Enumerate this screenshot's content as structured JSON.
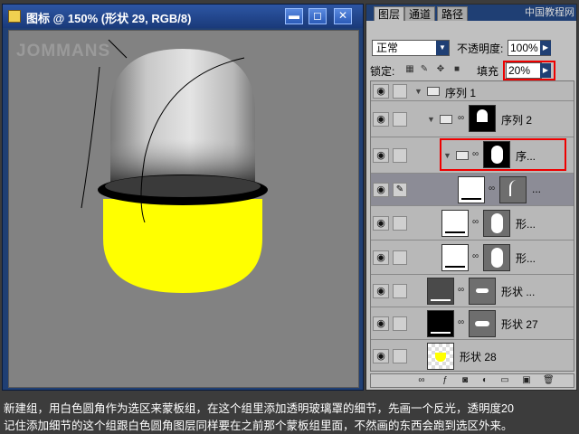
{
  "document": {
    "title": "图标 @ 150% (形状 29, RGB/8)",
    "watermark": "JOMMANS",
    "controls": {
      "minimize": "▬",
      "restore": "◻",
      "close": "✕"
    }
  },
  "layers_panel": {
    "tabs": [
      {
        "label": "图层",
        "active": true
      },
      {
        "label": "通道",
        "active": false
      },
      {
        "label": "路径",
        "active": false
      }
    ],
    "tabs_watermark": "中国教程网",
    "blend_mode": "正常",
    "opacity_label": "不透明度:",
    "opacity_value": "100%",
    "lock_label": "锁定:",
    "fill_label": "填充",
    "fill_value": "20%",
    "layers": [
      {
        "name": "序列 1",
        "type": "group"
      },
      {
        "name": "序列 2",
        "type": "group"
      },
      {
        "name": "序...",
        "type": "group"
      },
      {
        "name": "...",
        "type": "shape",
        "selected": true
      },
      {
        "name": "形...",
        "type": "shape"
      },
      {
        "name": "形...",
        "type": "shape"
      },
      {
        "name": "形状 ...",
        "type": "shape"
      },
      {
        "name": "形状 27",
        "type": "shape"
      },
      {
        "name": "形状 28",
        "type": "shape"
      }
    ]
  },
  "caption": {
    "line1": "新建组，用白色圆角作为选区来蒙板组，在这个组里添加透明玻璃罩的细节，先画一个反光，透明度20",
    "line2": "记住添加细节的这个组跟白色圆角图层同样要在之前那个蒙板组里面，不然画的东西会跑到选区外来。"
  },
  "colors": {
    "accent": "#e00000",
    "title_bar": "#1f3f74",
    "capsule_yellow": "#ffff00"
  }
}
